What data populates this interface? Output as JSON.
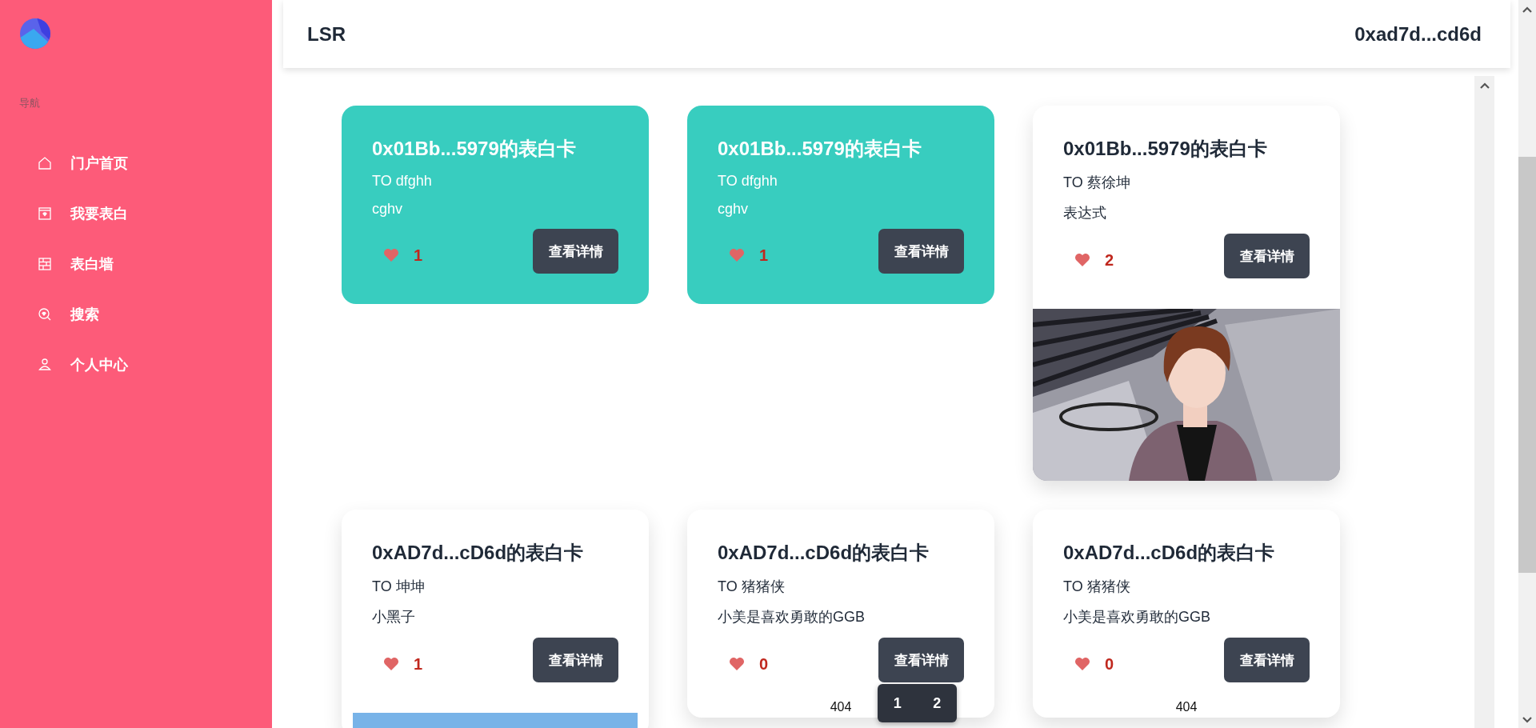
{
  "sidebar": {
    "section_label": "导航",
    "items": [
      {
        "label": "门户首页"
      },
      {
        "label": "我要表白"
      },
      {
        "label": "表白墙"
      },
      {
        "label": "搜索"
      },
      {
        "label": "个人中心"
      }
    ]
  },
  "header": {
    "title": "LSR",
    "account": "0xad7d...cd6d"
  },
  "cards": [
    {
      "title": "0x01Bb...5979的表白卡",
      "to": "TO dfghh",
      "message": "cghv",
      "likes": "1",
      "button": "查看详情",
      "color": "#38cdbf"
    },
    {
      "title": "0x01Bb...5979的表白卡",
      "to": "TO dfghh",
      "message": "cghv",
      "likes": "1",
      "button": "查看详情",
      "color": "#38cdbf"
    },
    {
      "title": "0x01Bb...5979的表白卡",
      "to": "TO 蔡徐坤",
      "message": "表达式",
      "likes": "2",
      "button": "查看详情",
      "color": "#ffffff"
    },
    {
      "title": "0xAD7d...cD6d的表白卡",
      "to": "TO 坤坤",
      "message": "小黑子",
      "likes": "1",
      "button": "查看详情",
      "color": "#ffffff"
    },
    {
      "title": "0xAD7d...cD6d的表白卡",
      "to": "TO 猪猪侠",
      "message": "小美是喜欢勇敢的GGB",
      "likes": "0",
      "button": "查看详情",
      "color": "#ffffff",
      "media": {
        "kind": "broken",
        "alt": "404"
      }
    },
    {
      "title": "0xAD7d...cD6d的表白卡",
      "to": "TO 猪猪侠",
      "message": "小美是喜欢勇敢的GGB",
      "likes": "0",
      "button": "查看详情",
      "color": "#ffffff",
      "media": {
        "kind": "broken",
        "alt": "404"
      }
    }
  ],
  "pagination": {
    "pages": [
      {
        "label": "1"
      },
      {
        "label": "2"
      }
    ]
  }
}
